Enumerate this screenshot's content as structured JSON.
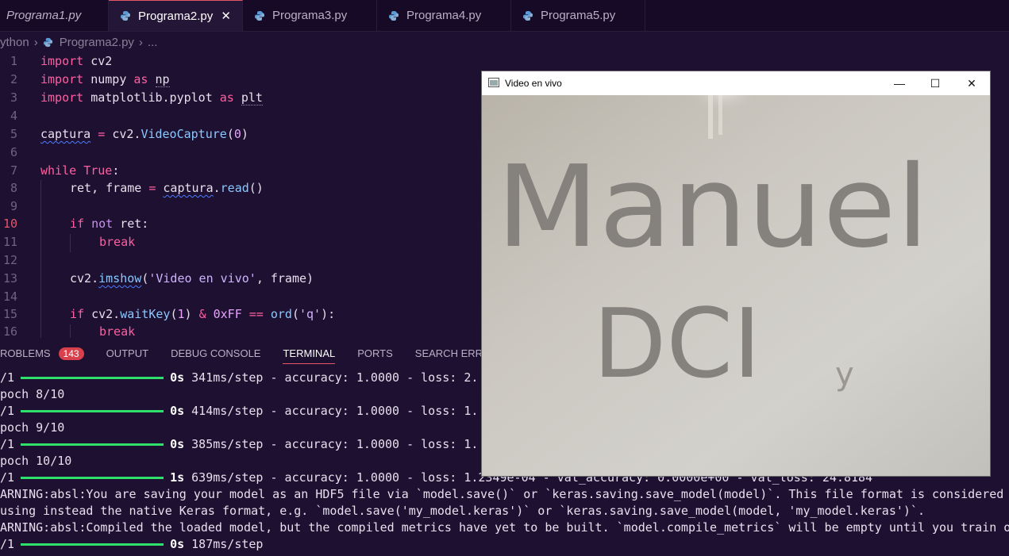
{
  "tabs": [
    {
      "label": "Programa1.py",
      "active": false
    },
    {
      "label": "Programa2.py",
      "active": true,
      "close": "✕"
    },
    {
      "label": "Programa3.py",
      "active": false
    },
    {
      "label": "Programa4.py",
      "active": false
    },
    {
      "label": "Programa5.py",
      "active": false
    }
  ],
  "breadcrumb": {
    "root": "ython",
    "file": "Programa2.py",
    "more": "..."
  },
  "editor": {
    "current_line": 10,
    "line_numbers": [
      "1",
      "2",
      "3",
      "4",
      "5",
      "6",
      "7",
      "8",
      "9",
      "10",
      "11",
      "12",
      "13",
      "14",
      "15",
      "16"
    ],
    "lines": {
      "l1": {
        "kw": "import",
        "mod": "cv2"
      },
      "l2": {
        "kw": "import",
        "mod": "numpy",
        "as": "as",
        "alias": "np"
      },
      "l3": {
        "kw": "import",
        "mod": "matplotlib.pyplot",
        "as": "as",
        "alias": "plt"
      },
      "l5": {
        "var": "captura",
        "eq": "=",
        "call": "cv2.",
        "fn": "VideoCapture",
        "open": "(",
        "num": "0",
        "close": ")"
      },
      "l7": {
        "kw": "while",
        "val": "True",
        "colon": ":"
      },
      "l8": {
        "lhs": "ret, frame",
        "eq": "=",
        "obj": "captura",
        "dot": ".",
        "fn": "read",
        "args": "()"
      },
      "l10": {
        "kw": "if",
        "kw2": "not",
        "rest": "ret:"
      },
      "l11": {
        "kw": "break"
      },
      "l13": {
        "obj": "cv2.",
        "fn": "imshow",
        "open": "(",
        "str": "'Video en vivo'",
        "rest": ", frame)"
      },
      "l15": {
        "kw": "if",
        "obj": "cv2.",
        "fn": "waitKey",
        "a1": "(",
        "num1": "1",
        "a2": ")",
        "amp": "&",
        "hex": "0xFF",
        "eqeq": "==",
        "fn2": "ord",
        "a3": "(",
        "str": "'q'",
        "a4": "):"
      },
      "l16": {
        "kw": "break"
      }
    }
  },
  "panel": {
    "tabs": [
      "ROBLEMS",
      "OUTPUT",
      "DEBUG CONSOLE",
      "TERMINAL",
      "PORTS",
      "SEARCH ERROR"
    ],
    "problems_count": "143",
    "active": "TERMINAL"
  },
  "terminal": {
    "lines": [
      {
        "pre": "/1",
        "time": "0s",
        "rest": " 341ms/step - accuracy: 1.0000 - loss: 2."
      },
      {
        "text": "poch 8/10"
      },
      {
        "pre": "/1",
        "time": "0s",
        "rest": " 414ms/step - accuracy: 1.0000 - loss: 1."
      },
      {
        "text": "poch 9/10"
      },
      {
        "pre": "/1",
        "time": "0s",
        "rest": " 385ms/step - accuracy: 1.0000 - loss: 1."
      },
      {
        "text": "poch 10/10"
      },
      {
        "pre": "/1",
        "time": "1s",
        "rest": " 639ms/step - accuracy: 1.0000 - loss: 1.2349e-04 - val_accuracy: 0.0000e+00 - val_loss: 24.8184"
      },
      {
        "text": "ARNING:absl:You are saving your model as an HDF5 file via `model.save()` or `keras.saving.save_model(model)`. This file format is considered"
      },
      {
        "text": "using instead the native Keras format, e.g. `model.save('my_model.keras')` or `keras.saving.save_model(model, 'my_model.keras')`."
      },
      {
        "text": "ARNING:absl:Compiled the loaded model, but the compiled metrics have yet to be built. `model.compile_metrics` will be empty until you train o"
      },
      {
        "pre": "/1",
        "time": "0s",
        "rest": " 187ms/step"
      }
    ]
  },
  "video_window": {
    "title": "Video en vivo",
    "minimize": "—",
    "maximize": "☐",
    "close": "✕",
    "handwriting": {
      "line1": "Manuel",
      "line2": "DCI",
      "mark": "y"
    }
  },
  "colors": {
    "accent": "#e4566a",
    "progress": "#2fe06a",
    "keyword": "#ff5fa2",
    "function": "#8ac8ff"
  }
}
